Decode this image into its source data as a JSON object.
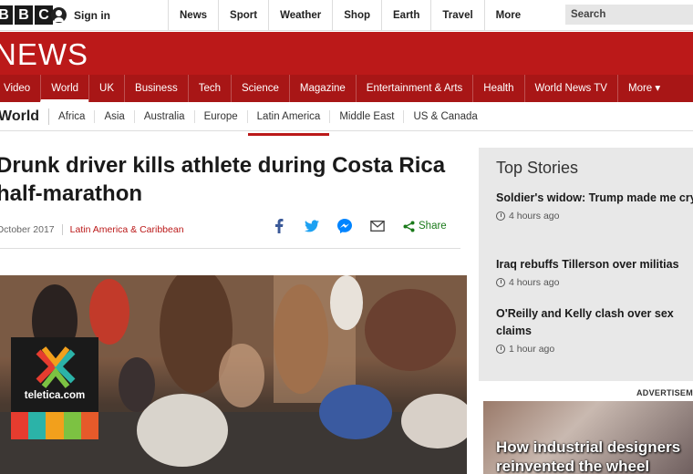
{
  "topbar": {
    "logo_letters": [
      "B",
      "B",
      "C"
    ],
    "sign_in": "Sign in",
    "nav": [
      "News",
      "Sport",
      "Weather",
      "Shop",
      "Earth",
      "Travel"
    ],
    "more": "More",
    "search_placeholder": "Search"
  },
  "banner": {
    "wordmark": "NEWS",
    "color": "#bb1919"
  },
  "section_nav": {
    "items": [
      "Video",
      "World",
      "UK",
      "Business",
      "Tech",
      "Science",
      "Magazine",
      "Entertainment & Arts",
      "Health",
      "World News TV",
      "More ▾"
    ],
    "active": "World"
  },
  "sub_nav": {
    "current": "World",
    "items": [
      "Africa",
      "Asia",
      "Australia",
      "Europe",
      "Latin America",
      "Middle East",
      "US & Canada"
    ],
    "active": "Latin America"
  },
  "article": {
    "headline": "Drunk driver kills athlete during Costa Rica half-marathon",
    "date": "October 2017",
    "section_tag": "Latin America & Caribbean",
    "share_label": "Share",
    "share_icons": [
      "facebook-icon",
      "twitter-icon",
      "messenger-icon",
      "email-icon",
      "share-icon"
    ]
  },
  "hero_logo": {
    "brand": "teletica.com",
    "stripe_colors": [
      "#e63c2f",
      "#f2a01c",
      "#2bb3a8",
      "#7cc242",
      "#e65a2a"
    ]
  },
  "top_stories": {
    "title": "Top Stories",
    "stories": [
      {
        "title": "Soldier's widow: Trump made me cry",
        "time": "4 hours ago"
      },
      {
        "title": "Iraq rebuffs Tillerson over militias",
        "time": "4 hours ago"
      },
      {
        "title": "O'Reilly and Kelly clash over sex claims",
        "time": "1 hour ago"
      }
    ]
  },
  "advertisement": {
    "label": "ADVERTISEMENT",
    "caption": "How industrial designers reinvented the wheel"
  }
}
